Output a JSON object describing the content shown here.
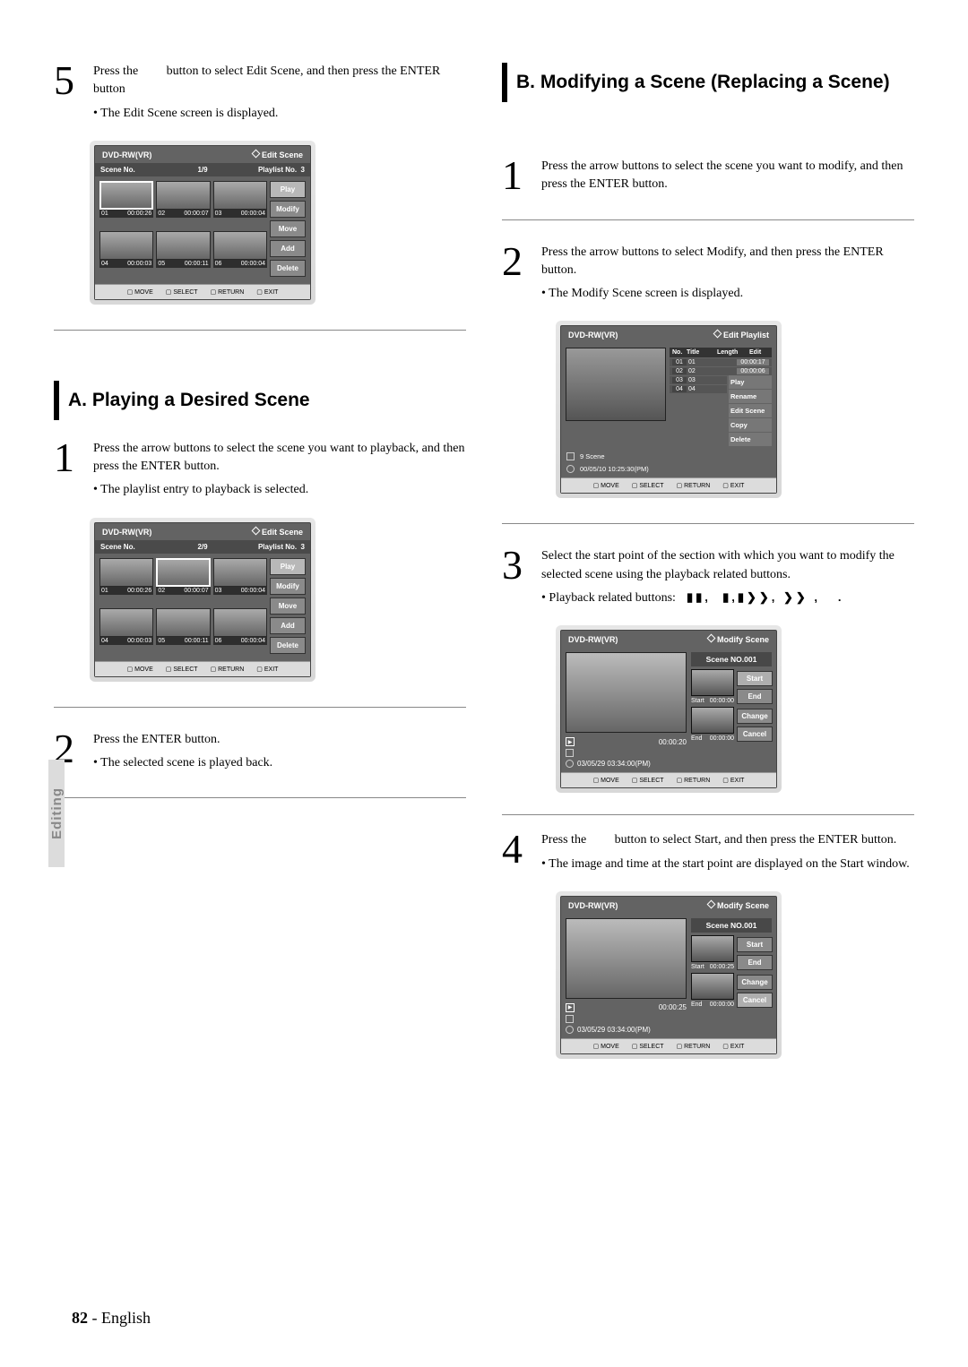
{
  "sideTab": "Editing",
  "pageFooter": {
    "num": "82",
    "sep": "-",
    "lang": "English"
  },
  "left": {
    "step5": {
      "text1": "Press the",
      "text2": "button to select Edit Scene, and then press the ENTER button",
      "bullet": "The Edit Scene screen is displayed."
    },
    "screenA": {
      "discType": "DVD-RW(VR)",
      "title": "Edit Scene",
      "sceneNoLabel": "Scene No.",
      "counter": "1/9",
      "playlistLabel": "Playlist No.",
      "playlistNum": "3",
      "buttons": [
        "Play",
        "Modify",
        "Move",
        "Add",
        "Delete"
      ],
      "thumbs": [
        {
          "n": "01",
          "t": "00:00:26"
        },
        {
          "n": "02",
          "t": "00:00:07"
        },
        {
          "n": "03",
          "t": "00:00:04"
        },
        {
          "n": "04",
          "t": "00:00:03"
        },
        {
          "n": "05",
          "t": "00:00:11"
        },
        {
          "n": "06",
          "t": "00:00:04"
        }
      ],
      "footer": [
        "MOVE",
        "SELECT",
        "RETURN",
        "EXIT"
      ]
    },
    "sectionA": "A. Playing a Desired Scene",
    "step1a": {
      "text": "Press the arrow buttons to select the scene you want to playback, and then press the ENTER button.",
      "bullet": "The playlist entry to playback is selected."
    },
    "screenB": {
      "discType": "DVD-RW(VR)",
      "title": "Edit Scene",
      "sceneNoLabel": "Scene No.",
      "counter": "2/9",
      "playlistLabel": "Playlist No.",
      "playlistNum": "3",
      "buttons": [
        "Play",
        "Modify",
        "Move",
        "Add",
        "Delete"
      ],
      "thumbs": [
        {
          "n": "01",
          "t": "00:00:26"
        },
        {
          "n": "02",
          "t": "00:00:07"
        },
        {
          "n": "03",
          "t": "00:00:04"
        },
        {
          "n": "04",
          "t": "00:00:03"
        },
        {
          "n": "05",
          "t": "00:00:11"
        },
        {
          "n": "06",
          "t": "00:00:04"
        }
      ],
      "footer": [
        "MOVE",
        "SELECT",
        "RETURN",
        "EXIT"
      ]
    },
    "step2a": {
      "text": "Press the ENTER button.",
      "bullet": "The selected scene is played back."
    }
  },
  "right": {
    "sectionB": "B. Modifying a Scene (Replacing a Scene)",
    "step1b": {
      "text": "Press the arrow buttons to select the scene you want to modify, and then press the ENTER button."
    },
    "step2b": {
      "text": "Press the arrow buttons to select Modify, and then press the ENTER button.",
      "bullet": "The Modify Scene screen is displayed."
    },
    "screenC": {
      "discType": "DVD-RW(VR)",
      "title": "Edit Playlist",
      "listHead": {
        "no": "No.",
        "title": "Title",
        "length": "Length",
        "edit": "Edit"
      },
      "rows": [
        {
          "no": "01",
          "title": "01",
          "len": "00:00:17"
        },
        {
          "no": "02",
          "title": "02",
          "len": "00:00:06"
        },
        {
          "no": "03",
          "title": "03",
          "len": ""
        },
        {
          "no": "04",
          "title": "04",
          "len": ""
        }
      ],
      "menu": [
        "Play",
        "Rename",
        "Edit Scene",
        "Copy",
        "Delete"
      ],
      "info1": "9 Scene",
      "info2": "00/05/10  10:25:30(PM)",
      "footer": [
        "MOVE",
        "SELECT",
        "RETURN",
        "EXIT"
      ]
    },
    "step3b": {
      "text": "Select the start point of the section with which you want to modify the selected scene using the playback related buttons.",
      "bullet": "Playback related buttons:"
    },
    "screenD": {
      "discType": "DVD-RW(VR)",
      "title": "Modify Scene",
      "sceneTitle": "Scene NO.001",
      "playTime": "00:00:20",
      "meta": "03/05/29 03:34:00(PM)",
      "startLabel": "Start",
      "startTime": "00:00:00",
      "endLabel": "End",
      "endTime": "00:00:00",
      "buttons": [
        "Start",
        "End",
        "Change",
        "Cancel"
      ],
      "footer": [
        "MOVE",
        "SELECT",
        "RETURN",
        "EXIT"
      ]
    },
    "step4b": {
      "text1": "Press the",
      "text2": "button to select Start, and then press the ENTER button.",
      "bullet": "The image and time at the start point are displayed on the Start window."
    },
    "screenE": {
      "discType": "DVD-RW(VR)",
      "title": "Modify Scene",
      "sceneTitle": "Scene NO.001",
      "playTime": "00:00:25",
      "meta": "03/05/29 03:34:00(PM)",
      "startLabel": "Start",
      "startTime": "00:00:25",
      "endLabel": "End",
      "endTime": "00:00:00",
      "buttons": [
        "Start",
        "End",
        "Change",
        "Cancel"
      ],
      "footer": [
        "MOVE",
        "SELECT",
        "RETURN",
        "EXIT"
      ]
    }
  }
}
